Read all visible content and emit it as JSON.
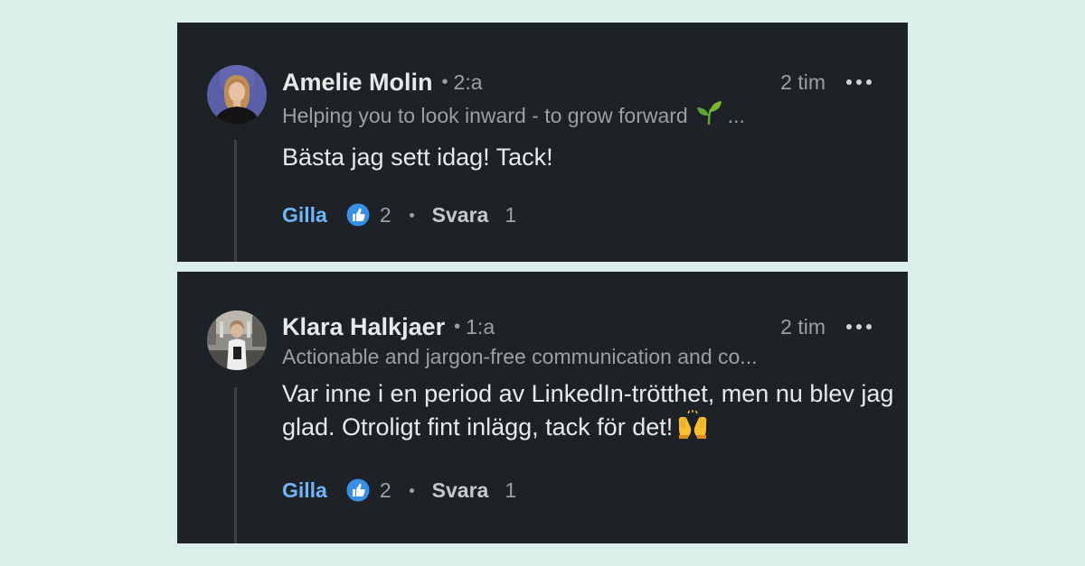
{
  "comments": [
    {
      "author": "Amelie Molin",
      "separator": "•",
      "degree": "2:a",
      "time": "2 tim",
      "headline": "Helping you to look inward - to grow forward",
      "headline_suffix": "...",
      "headline_emoji": "seedling-icon",
      "text": "Bästa jag sett idag! Tack!",
      "like_label": "Gilla",
      "like_count": "2",
      "reply_label": "Svara",
      "reply_count": "1"
    },
    {
      "author": "Klara Halkjaer",
      "separator": "•",
      "degree": "1:a",
      "time": "2 tim",
      "headline": "Actionable and jargon-free communication and co...",
      "text": "Var inne i en period av LinkedIn-trötthet, men nu blev jag glad. Otroligt fint inlägg, tack för det!",
      "text_emoji": "raised-hands-icon",
      "like_label": "Gilla",
      "like_count": "2",
      "reply_label": "Svara",
      "reply_count": "1"
    }
  ],
  "colors": {
    "page_background": "#dbeeea",
    "card_background": "#1d2226",
    "primary_text": "#e9e9e9",
    "secondary_text": "#9aa0a6",
    "like_blue": "#70b5f9",
    "reaction_icon_blue": "#378fe9"
  }
}
